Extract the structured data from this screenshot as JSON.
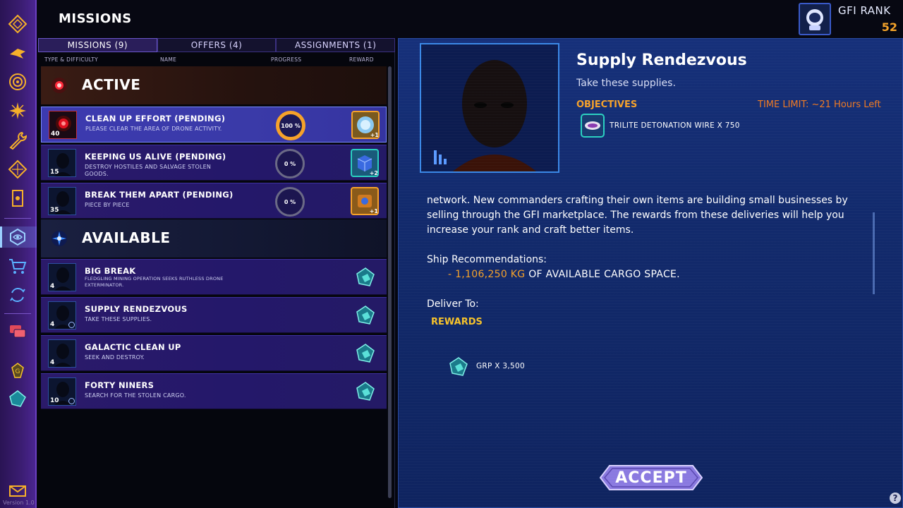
{
  "header": {
    "title": "MISSIONS",
    "rank_label": "GFI RANK",
    "rank_value": "52"
  },
  "tabs": [
    {
      "label": "MISSIONS",
      "count": "(9)"
    },
    {
      "label": "OFFERS",
      "count": "(4)"
    },
    {
      "label": "ASSIGNMENTS",
      "count": "(1)"
    }
  ],
  "columns": {
    "type": "TYPE & DIFFICULTY",
    "name": "NAME",
    "progress": "PROGRESS",
    "reward": "REWARD"
  },
  "sections": {
    "active": "ACTIVE",
    "available": "AVAILABLE"
  },
  "active_missions": [
    {
      "name": "CLEAN UP EFFORT (PENDING)",
      "desc": "PLEASE CLEAR THE AREA OF DRONE ACTIVITY.",
      "level": "40",
      "progress": "100 %",
      "reward_plus": "+1"
    },
    {
      "name": "KEEPING US ALIVE (PENDING)",
      "desc": "DESTROY HOSTILES AND SALVAGE STOLEN GOODS.",
      "level": "15",
      "progress": "0 %",
      "reward_plus": "+2"
    },
    {
      "name": "BREAK THEM APART (PENDING)",
      "desc": "PIECE BY PIECE",
      "level": "35",
      "progress": "0 %",
      "reward_plus": "+1"
    }
  ],
  "available_missions": [
    {
      "name": "BIG BREAK",
      "desc": "FLEDGLING MINING OPERATION SEEKS RUTHLESS DRONE EXTERMINATOR.",
      "level": "4"
    },
    {
      "name": "SUPPLY RENDEZVOUS",
      "desc": "TAKE THESE SUPPLIES.",
      "level": "4"
    },
    {
      "name": "GALACTIC CLEAN UP",
      "desc": "SEEK AND DESTROY.",
      "level": "4"
    },
    {
      "name": "FORTY NINERS",
      "desc": "SEARCH FOR THE STOLEN CARGO.",
      "level": "10"
    }
  ],
  "detail": {
    "title": "Supply Rendezvous",
    "subtitle": "Take these supplies.",
    "objectives_label": "OBJECTIVES",
    "time_limit": "TIME LIMIT: ~21 Hours Left",
    "objective_item": "TRILITE DETONATION WIRE  X 750",
    "body": "network. New commanders crafting their own items are building small businesses by selling through the GFI marketplace. The rewards from these deliveries will help you increase your rank and craft better items.",
    "ship_rec": "Ship Recommendations:",
    "cargo_amount": "- 1,106,250 KG",
    "cargo_text": " OF AVAILABLE CARGO SPACE.",
    "deliver_to": "Deliver To:",
    "rewards_label": "REWARDS",
    "reward_item": "GRP X 3,500",
    "accept_label": "ACCEPT"
  },
  "version": "Version 1.0",
  "help_label": "?"
}
